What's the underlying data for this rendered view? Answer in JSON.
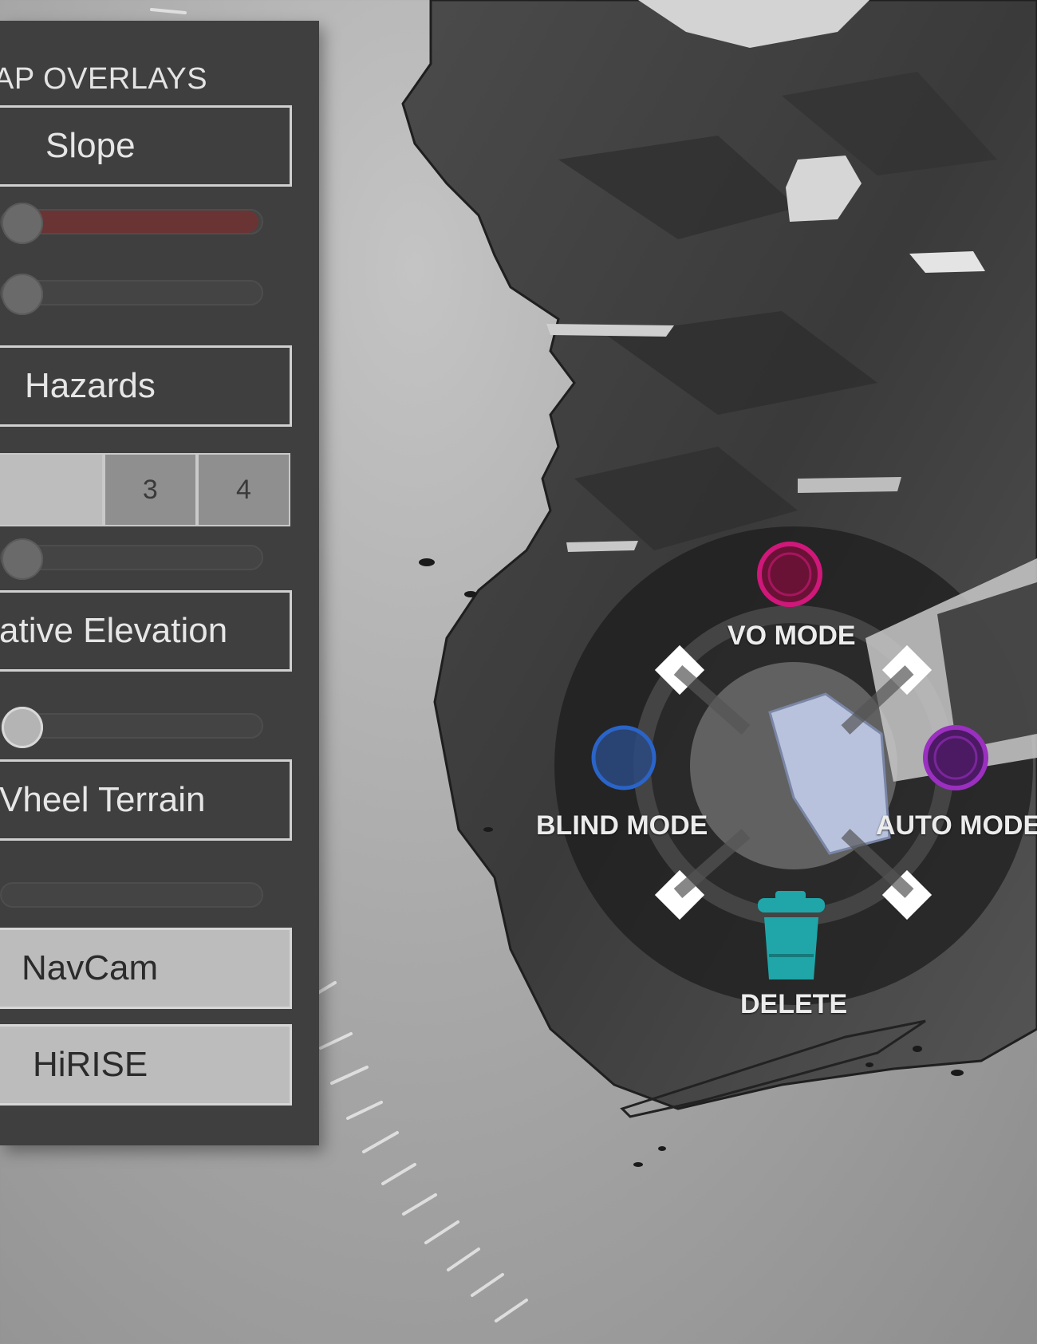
{
  "overlays_panel": {
    "title": "AP OVERLAYS",
    "layers": [
      {
        "label": "Slope"
      },
      {
        "label": "Hazards",
        "levels": [
          "",
          "3",
          "4"
        ]
      },
      {
        "label": "ative Elevation"
      },
      {
        "label": "Vheel Terrain"
      },
      {
        "label": "NavCam"
      },
      {
        "label": "HiRISE"
      }
    ]
  },
  "radial_menu": {
    "top": {
      "label": "VO MODE",
      "color": "#d0177a"
    },
    "left": {
      "label": "BLIND MODE",
      "color": "#2a64c8"
    },
    "right": {
      "label": "AUTO MODE",
      "color": "#9a2fc0"
    },
    "bottom": {
      "label": "DELETE",
      "color": "#20a6a8",
      "icon": "trash-icon"
    }
  }
}
